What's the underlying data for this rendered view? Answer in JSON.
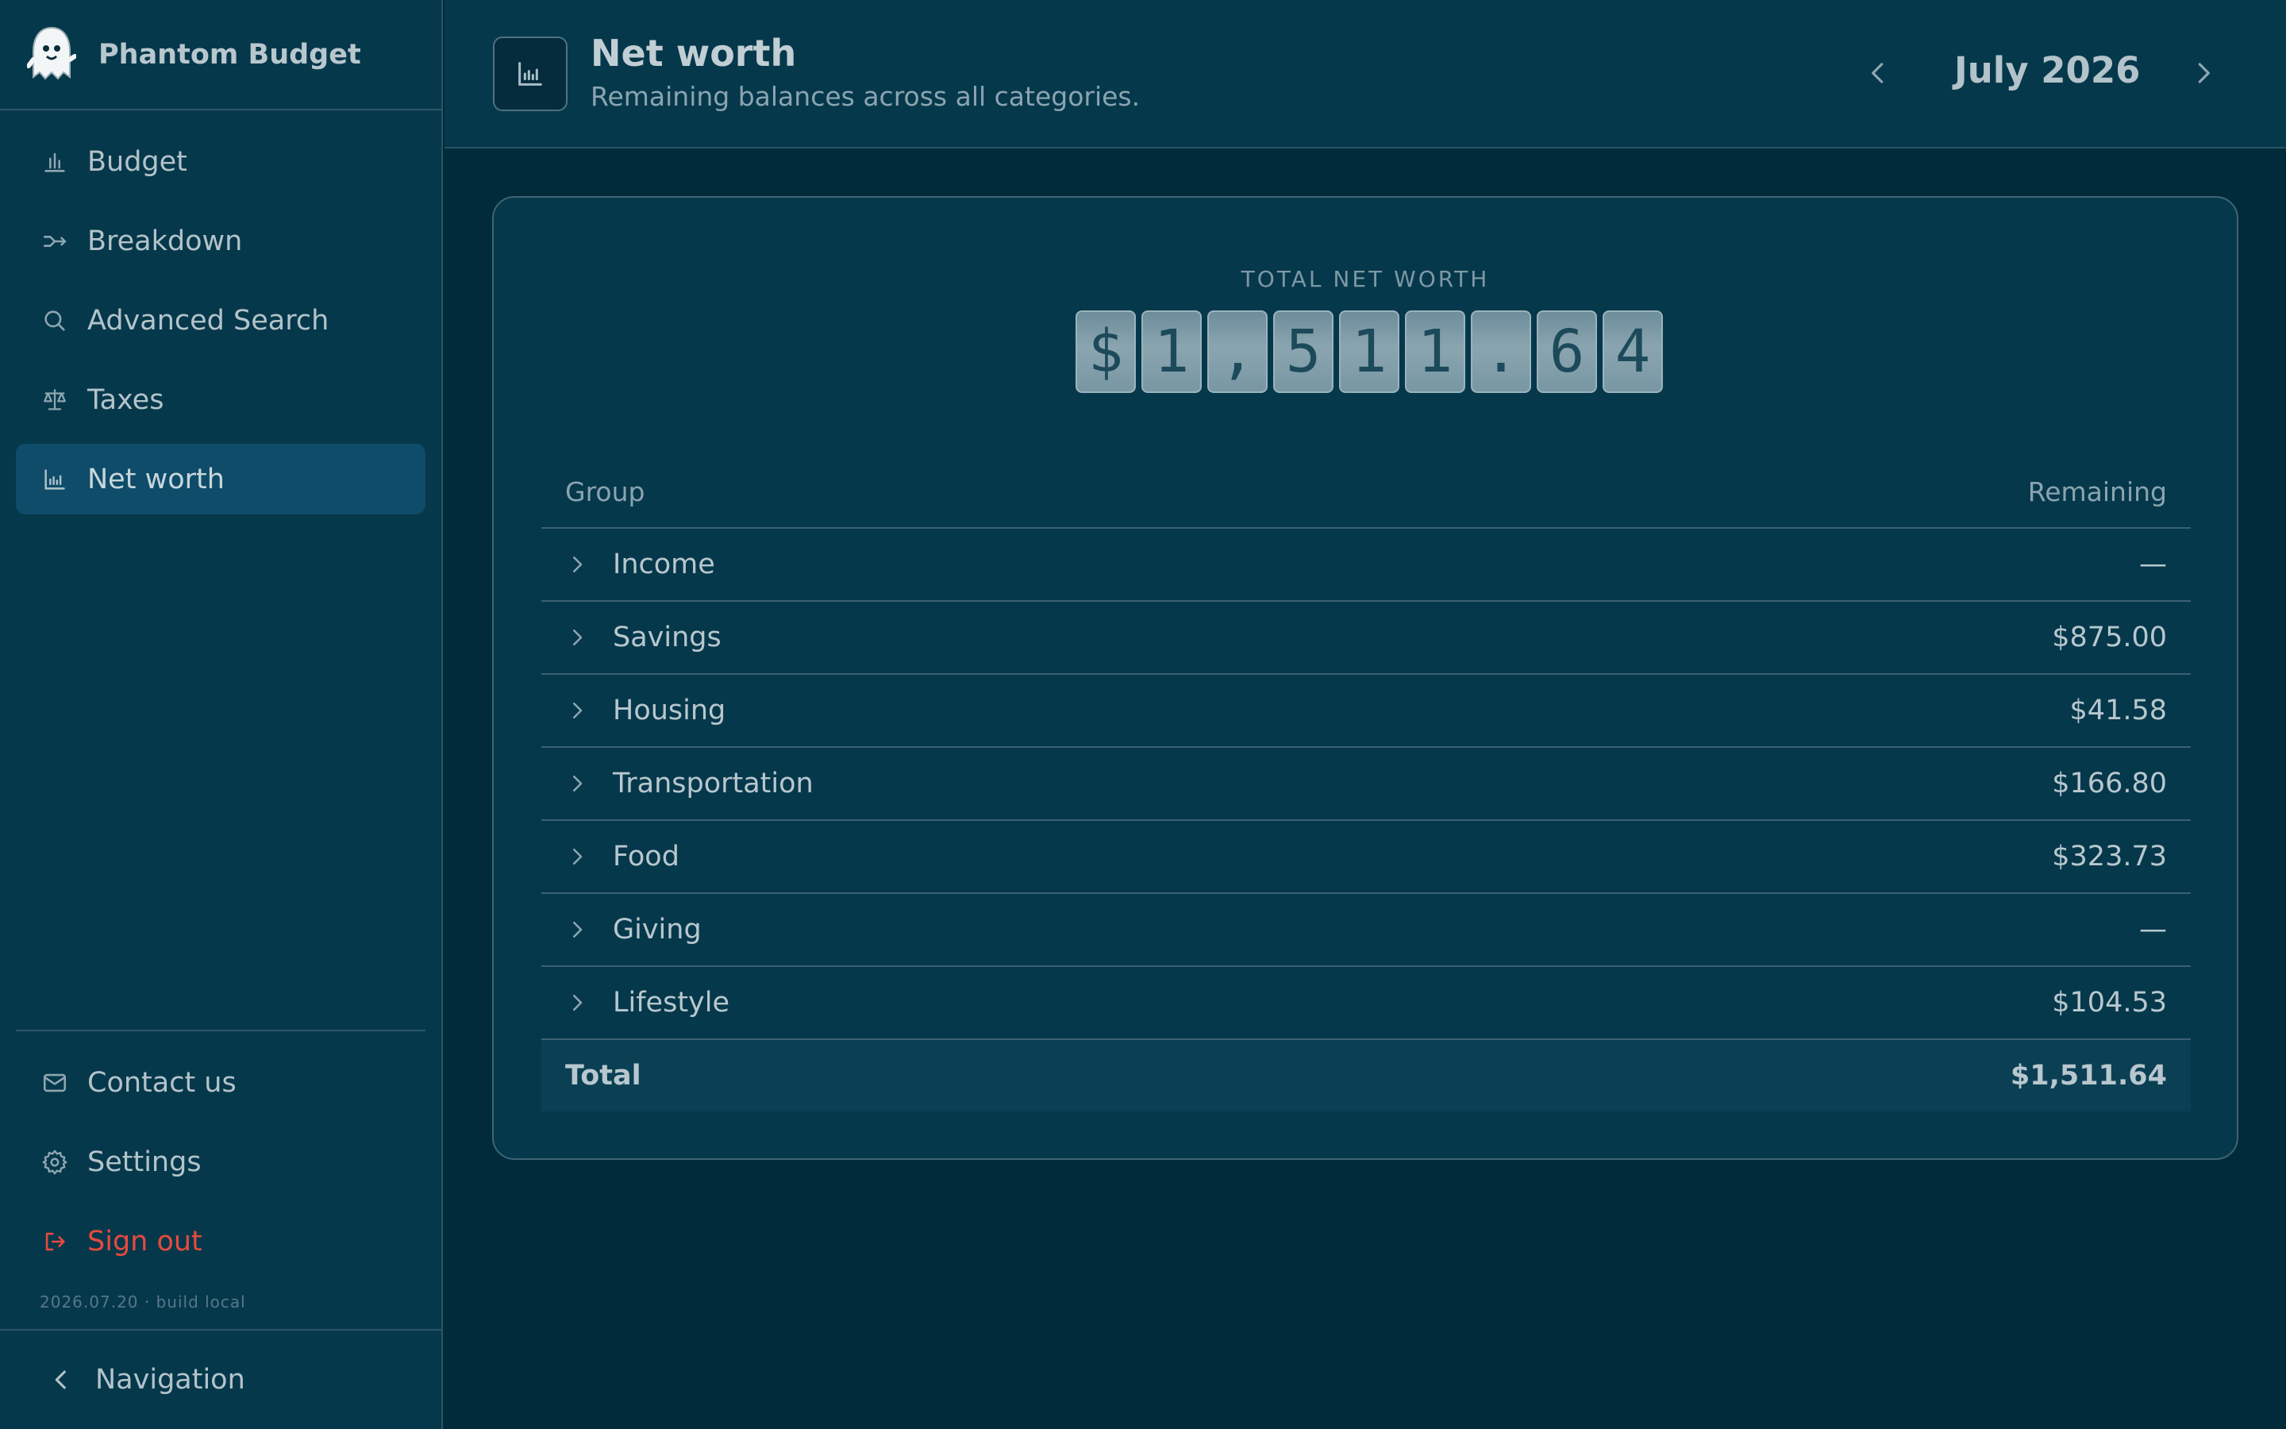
{
  "app": {
    "name": "Phantom Budget"
  },
  "sidebar": {
    "items": [
      {
        "label": "Budget",
        "icon": "bar-chart-icon"
      },
      {
        "label": "Breakdown",
        "icon": "split-icon"
      },
      {
        "label": "Advanced Search",
        "icon": "search-icon"
      },
      {
        "label": "Taxes",
        "icon": "scale-icon"
      },
      {
        "label": "Net worth",
        "icon": "line-chart-icon",
        "active": true
      }
    ],
    "bottom_items": [
      {
        "label": "Contact us",
        "icon": "mail-icon"
      },
      {
        "label": "Settings",
        "icon": "gear-icon"
      },
      {
        "label": "Sign out",
        "icon": "sign-out-icon"
      }
    ],
    "build": "2026.07.20 · build local",
    "footer_label": "Navigation"
  },
  "header": {
    "title": "Net worth",
    "subtitle": "Remaining balances across all categories.",
    "month": "July 2026"
  },
  "summary": {
    "label": "TOTAL NET WORTH",
    "digits": [
      "$",
      "1",
      ",",
      "5",
      "1",
      "1",
      ".",
      "6",
      "4"
    ]
  },
  "table": {
    "columns": {
      "group": "Group",
      "remaining": "Remaining"
    },
    "rows": [
      {
        "name": "Income",
        "value": "—"
      },
      {
        "name": "Savings",
        "value": "$875.00"
      },
      {
        "name": "Housing",
        "value": "$41.58"
      },
      {
        "name": "Transportation",
        "value": "$166.80"
      },
      {
        "name": "Food",
        "value": "$323.73"
      },
      {
        "name": "Giving",
        "value": "—"
      },
      {
        "name": "Lifestyle",
        "value": "$104.53"
      }
    ],
    "total": {
      "label": "Total",
      "value": "$1,511.64"
    }
  },
  "colors": {
    "background": "#012a3a",
    "panel": "#06384b",
    "active": "#0e4c69",
    "danger": "#e64a3e"
  }
}
